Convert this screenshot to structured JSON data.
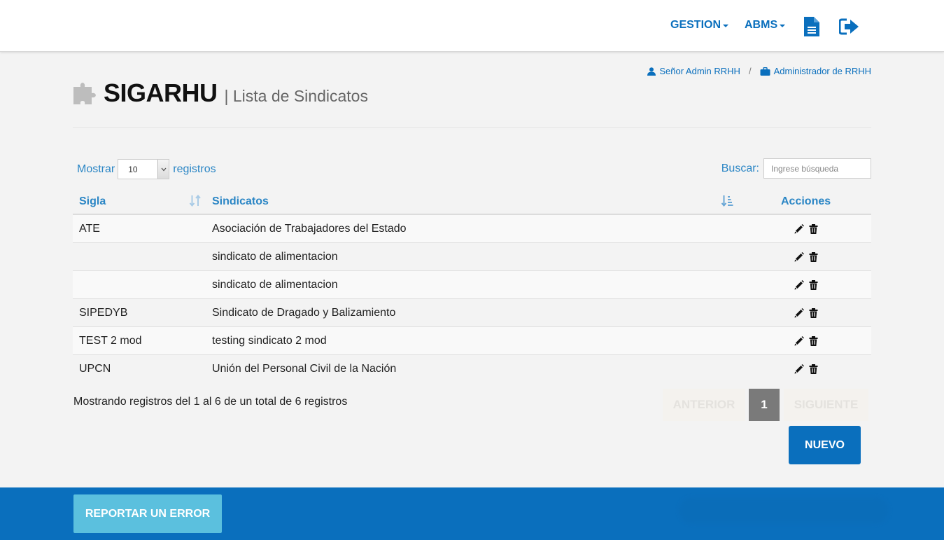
{
  "nav": {
    "gestion": "GESTION",
    "abms": "ABMS",
    "doc_icon": "document-icon",
    "logout_icon": "sign-out-icon"
  },
  "user": {
    "name": "Señor Admin RRHH",
    "separator": "/",
    "role": "Administrador de RRHH"
  },
  "header": {
    "title": "SIGARHU",
    "subtitle": "| Lista de Sindicatos"
  },
  "controls": {
    "show_label": "Mostrar",
    "page_size": "10",
    "records_label": "registros",
    "search_label": "Buscar:",
    "search_placeholder": "Ingrese búsqueda"
  },
  "table": {
    "columns": [
      "Sigla",
      "Sindicatos",
      "Acciones"
    ],
    "rows": [
      {
        "sigla": "ATE",
        "nombre": "Asociación de Trabajadores del Estado"
      },
      {
        "sigla": "",
        "nombre": "sindicato de alimentacion"
      },
      {
        "sigla": "",
        "nombre": "sindicato de alimentacion"
      },
      {
        "sigla": "SIPEDYB",
        "nombre": "Sindicato de Dragado y Balizamiento"
      },
      {
        "sigla": "TEST 2 mod",
        "nombre": "testing sindicato 2 mod"
      },
      {
        "sigla": "UPCN",
        "nombre": "Unión del Personal Civil de la Nación"
      }
    ]
  },
  "info": "Mostrando registros del 1 al 6 de un total de 6 registros",
  "pager": {
    "prev": "ANTERIOR",
    "current": "1",
    "next": "SIGUIENTE"
  },
  "buttons": {
    "nuevo": "NUEVO",
    "report": "REPORTAR UN ERROR"
  },
  "colors": {
    "primary": "#0a6fbd",
    "link": "#2b86c5",
    "report": "#5bc0de"
  }
}
